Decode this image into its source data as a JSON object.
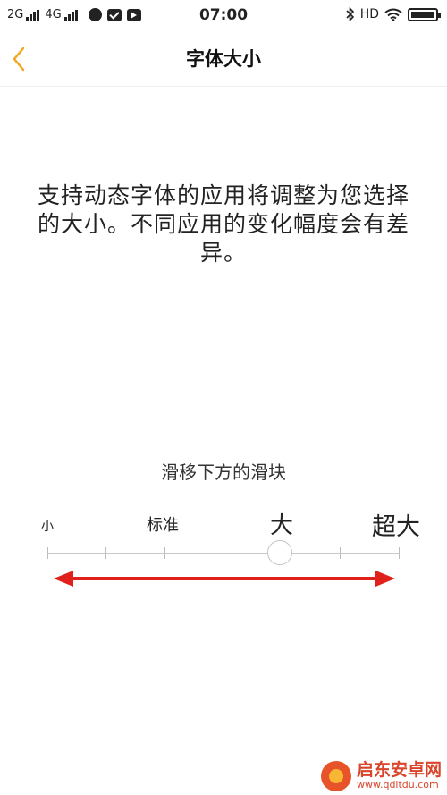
{
  "status_bar": {
    "sim1": "2G",
    "sim2": "4G",
    "time": "07:00",
    "network_type": "HD",
    "icons": [
      "signal-icon",
      "app-notification-icon",
      "message-icon",
      "video-icon",
      "bluetooth-icon",
      "wifi-icon",
      "battery-icon"
    ]
  },
  "nav": {
    "title": "字体大小",
    "back_icon": "chevron-left-icon",
    "accent_color": "#f5a623"
  },
  "description": "支持动态字体的应用将调整为您选择的大小。不同应用的变化幅度会有差异。",
  "slider": {
    "hint": "滑移下方的滑块",
    "labels": {
      "small": "小",
      "standard": "标准",
      "large": "大",
      "extra_large": "超大"
    },
    "tick_count": 7,
    "selected_index": 4,
    "annotation_color": "#e0201b"
  },
  "watermark": {
    "name": "启东安卓网",
    "url": "www.qdltdu.com"
  }
}
